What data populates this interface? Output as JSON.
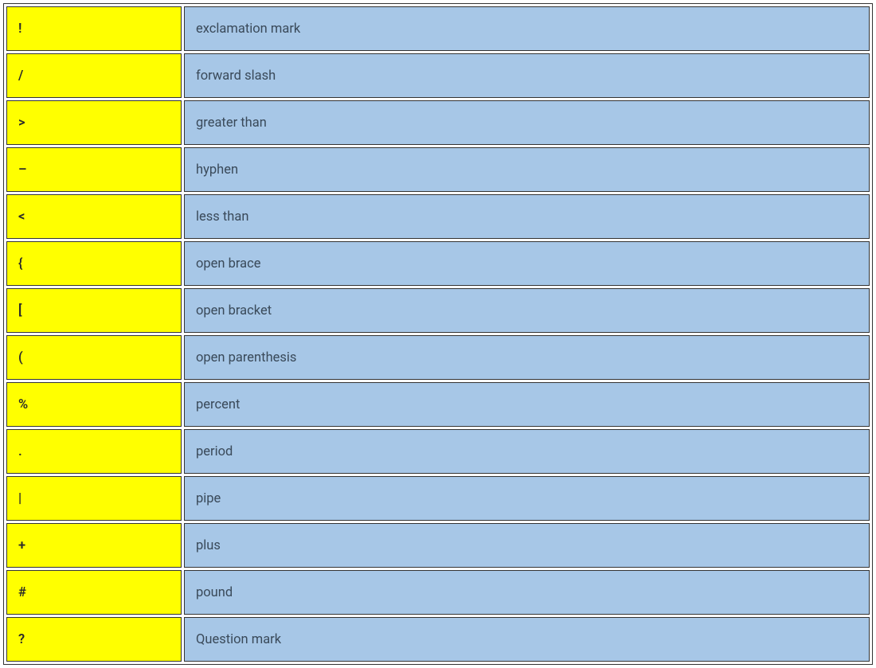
{
  "rows": [
    {
      "symbol": "!",
      "description": "exclamation mark"
    },
    {
      "symbol": "/",
      "description": "forward slash"
    },
    {
      "symbol": ">",
      "description": "greater than"
    },
    {
      "symbol": "–",
      "description": "hyphen"
    },
    {
      "symbol": "<",
      "description": "less than"
    },
    {
      "symbol": "{",
      "description": "open brace"
    },
    {
      "symbol": "[",
      "description": "open bracket"
    },
    {
      "symbol": "(",
      "description": "open parenthesis"
    },
    {
      "symbol": "%",
      "description": "percent"
    },
    {
      "symbol": ".",
      "description": "period"
    },
    {
      "symbol": "|",
      "description": "pipe"
    },
    {
      "symbol": "+",
      "description": "plus"
    },
    {
      "symbol": "#",
      "description": "pound"
    },
    {
      "symbol": "?",
      "description": "Question mark"
    }
  ],
  "colors": {
    "symbol_bg": "#ffff00",
    "desc_bg": "#a7c7e7",
    "border": "#333333"
  }
}
